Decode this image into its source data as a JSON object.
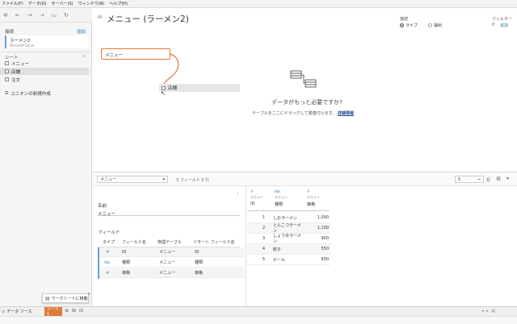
{
  "menubar": {
    "items": [
      "ファイル(F)",
      "データ(D)",
      "サーバー(S)",
      "ウィンドウ(N)",
      "ヘルプ(H)"
    ]
  },
  "toolbar": {
    "icons": [
      "tableau-logo-icon",
      "back-icon",
      "forward-icon",
      "redo-icon",
      "save-icon",
      "refresh-icon"
    ]
  },
  "left": {
    "connections_title": "接続",
    "add_label": "追加",
    "connection": {
      "name": "ラーメン2",
      "type": "Microsoft Excel"
    },
    "sheets_title": "シート",
    "sheets": [
      {
        "label": "メニュー",
        "selected": false
      },
      {
        "label": "店舗",
        "selected": true
      },
      {
        "label": "注文",
        "selected": false
      }
    ],
    "new_union": "ユニオンの新規作成"
  },
  "canvas": {
    "title": "メニュー (ラーメン2)",
    "connection_label": "接続",
    "live_label": "ライブ",
    "extract_label": "抽出",
    "filter_label": "フィルター",
    "filter_count": "0",
    "filter_add": "追加",
    "table_primary": "メニュー",
    "table_dragging": "店舗",
    "need_more": "データがもっと必要ですか?",
    "drag_hint": "テーブルをここにドラッグして関連付けます。",
    "details_link": "詳細情報",
    "accent_color": "#e07b39"
  },
  "grid_toolbar": {
    "table_select": "メニュー",
    "field_count": "3 フィールド 5 行",
    "rows_value": "5",
    "rows_label": "行"
  },
  "meta": {
    "name_label": "名前",
    "name_value": "メニュー",
    "fields_label": "フィールド",
    "headers": [
      "タイプ",
      "フィールド名",
      "物理テーブル",
      "リモート フィールド名"
    ],
    "rows": [
      {
        "type_icon": "number-icon",
        "type": "#",
        "field": "ID",
        "table": "メニュー",
        "remote": "ID"
      },
      {
        "type_icon": "string-icon",
        "type": "Abc",
        "field": "種類",
        "table": "メニュー",
        "remote": "種類"
      },
      {
        "type_icon": "number-icon",
        "type": "#",
        "field": "価格",
        "table": "メニュー",
        "remote": "価格"
      }
    ]
  },
  "grid": {
    "columns": [
      {
        "type": "#",
        "source": "メニュー",
        "name": "ID"
      },
      {
        "type": "Abc",
        "source": "メニュー",
        "name": "種類"
      },
      {
        "type": "#",
        "source": "メニュー",
        "name": "価格"
      }
    ],
    "rows": [
      [
        "1",
        "しおラーメン",
        "1,000"
      ],
      [
        "2",
        "とんこつラーメン",
        "1,100"
      ],
      [
        "3",
        "しょうゆラーメン",
        "900"
      ],
      [
        "4",
        "餃子",
        "550"
      ],
      [
        "5",
        "ビール",
        "600"
      ]
    ]
  },
  "status": {
    "datasource_tab": "データ ソース",
    "sheet_tab": "シート 1",
    "goto_worksheet": "ワークシートに移動"
  }
}
